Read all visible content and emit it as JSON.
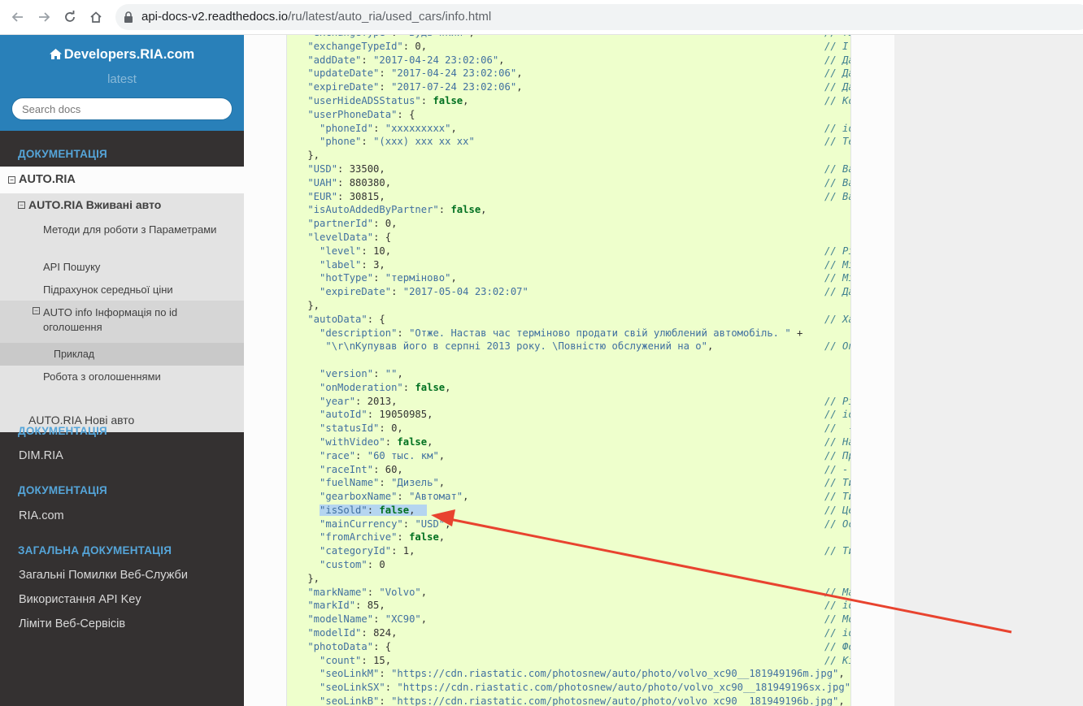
{
  "browser": {
    "url_host": "api-docs-v2.readthedocs.io",
    "url_path": "/ru/latest/auto_ria/used_cars/info.html"
  },
  "sidebar": {
    "brand": "Developers.RIA.com",
    "version": "latest",
    "search_placeholder": "Search docs",
    "caption1": "ДОКУМЕНТАЦІЯ",
    "current_l1": "AUTO.RIA",
    "current_l2": "AUTO.RIA Вживані авто",
    "l3_items": [
      "Методи для роботи з Параметрами",
      "API Пошуку",
      "Підрахунок середньої ціни",
      "AUTO info Інформація по id оголошення",
      "Робота з оголошеннями"
    ],
    "l4_item": "Приклад",
    "l2_next": "AUTO.RIA Нові авто",
    "caption2": "ДОКУМЕНТАЦІЯ",
    "item_dim": "DIM.RIA",
    "caption3": "ДОКУМЕНТАЦІЯ",
    "item_ria": "RIA.com",
    "caption4": "ЗАГАЛЬНА ДОКУМЕНТАЦІЯ",
    "general_items": [
      "Загальні Помилки Веб-Служби",
      "Використання API Key",
      "Ліміти Веб-Сервісів"
    ]
  },
  "code_lines": [
    " \"exchangeType\": \"Будь-який\",",
    " \"exchangeTypeId\": 0,",
    " \"addDate\": \"2017-04-24 23:02:06\",",
    " \"updateDate\": \"2017-04-24 23:02:06\",",
    " \"expireDate\": \"2017-07-24 23:02:06\",",
    " \"userHideADSStatus\": false,",
    " \"userPhoneData\": {",
    "   \"phoneId\": \"xxxxxxxxx\",",
    "   \"phone\": \"(xxx) xxx xx xx\"",
    " },",
    " \"USD\": 33500,",
    " \"UAH\": 880380,",
    " \"EUR\": 30815,",
    " \"isAutoAddedByPartner\": false,",
    " \"partnerId\": 0,",
    " \"levelData\": {",
    "   \"level\": 10,",
    "   \"label\": 3,",
    "   \"hotType\": \"терміново\",",
    "   \"expireDate\": \"2017-05-04 23:02:07\"",
    " },",
    " \"autoData\": {",
    "   \"description\": \"Отже. Настав час терміново продати свій улюблений автомобіль. \" +",
    "    \"\\r\\nКупував його в серпні 2013 року. \\Повністю обслужений на о\",",
    "",
    "   \"version\": \"\",",
    "   \"onModeration\": false,",
    "   \"year\": 2013,",
    "   \"autoId\": 19050985,",
    "   \"statusId\": 0,",
    "   \"withVideo\": false,",
    "   \"race\": \"60 тыс. км\",",
    "   \"raceInt\": 60,",
    "   \"fuelName\": \"Дизель\",",
    "   \"gearboxName\": \"Автомат\",",
    "   \"isSold\": false,",
    "   \"mainCurrency\": \"USD\",",
    "   \"fromArchive\": false,",
    "   \"categoryId\": 1,",
    "   \"custom\": 0",
    " },",
    " \"markName\": \"Volvo\",",
    " \"markId\": 85,",
    " \"modelName\": \"XC90\",",
    " \"modelId\": 824,",
    " \"photoData\": {",
    "   \"count\": 15,",
    "   \"seoLinkM\": \"https://cdn.riastatic.com/photosnew/auto/photo/volvo_xc90__181949196m.jpg\",",
    "   \"seoLinkSX\": \"https://cdn.riastatic.com/photosnew/auto/photo/volvo_xc90__181949196sx.jpg\",",
    "   \"seoLinkB\": \"https://cdn.riastatic.com/photosnew/auto/photo/volvo_xc90__181949196b.jpg\","
  ],
  "comment_lines": [
    "// Ti",
    "// I",
    "// Да",
    "// Да",
    "// Да",
    "// Ко",
    "",
    "// id",
    "// Те",
    "",
    "// Ва",
    "// Ва",
    "// Ва",
    "",
    "",
    "",
    "// Рі",
    "// Мі",
    "// Мі",
    "// Да",
    "",
    "// Ха",
    "",
    "// Оп",
    "",
    "",
    "",
    "// Рі",
    "// id",
    "//  -",
    "// На",
    "// Пр",
    "// -",
    "// Ти",
    "// Ти",
    "// Це",
    "// Ос",
    "",
    "// Ти",
    "",
    "",
    "// Ма",
    "// id",
    "// Мо",
    "// id",
    "// Фо",
    "// Кі",
    "",
    "",
    ""
  ]
}
